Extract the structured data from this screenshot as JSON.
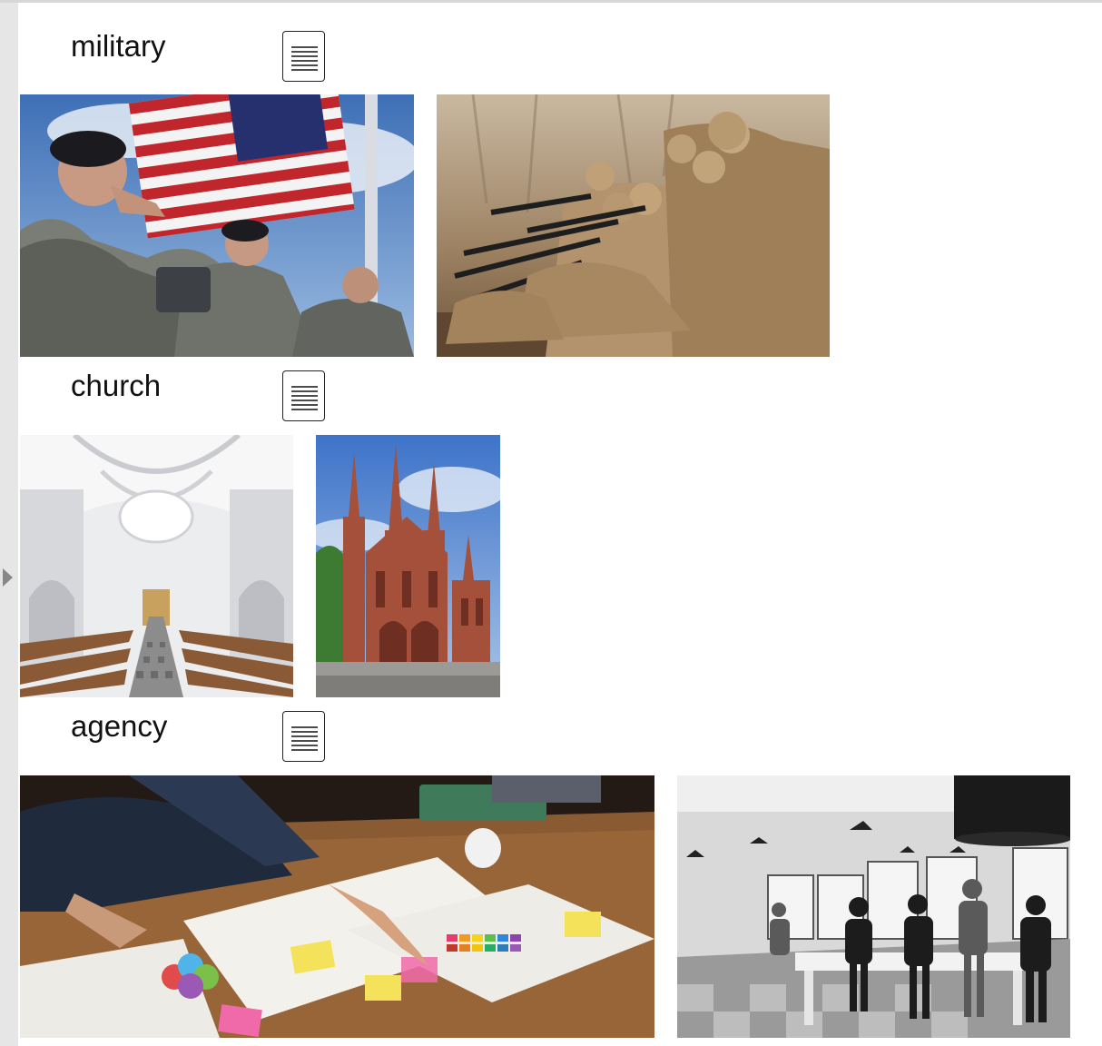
{
  "sections": [
    {
      "label": "military",
      "button_icon": "document-lines-icon",
      "images": [
        {
          "name": "military-salute-flag-image",
          "subject": "soldiers saluting American flag"
        },
        {
          "name": "military-soldiers-rifles-image",
          "subject": "kneeling soldiers aiming rifles"
        }
      ]
    },
    {
      "label": "church",
      "button_icon": "document-lines-icon",
      "images": [
        {
          "name": "church-interior-image",
          "subject": "white baroque church interior"
        },
        {
          "name": "church-gothic-exterior-image",
          "subject": "red brick gothic church"
        }
      ]
    },
    {
      "label": "agency",
      "button_icon": "document-lines-icon",
      "images": [
        {
          "name": "agency-desk-planning-image",
          "subject": "hands over desk with papers and sticky notes"
        },
        {
          "name": "agency-office-team-image",
          "subject": "black and white office team standing"
        }
      ]
    }
  ],
  "colors": {
    "rail": "#e6e6e6",
    "sky_blue": "#5b86c4",
    "camo": "#6e6f66",
    "desert": "#b38d62",
    "brick": "#a4503a"
  }
}
